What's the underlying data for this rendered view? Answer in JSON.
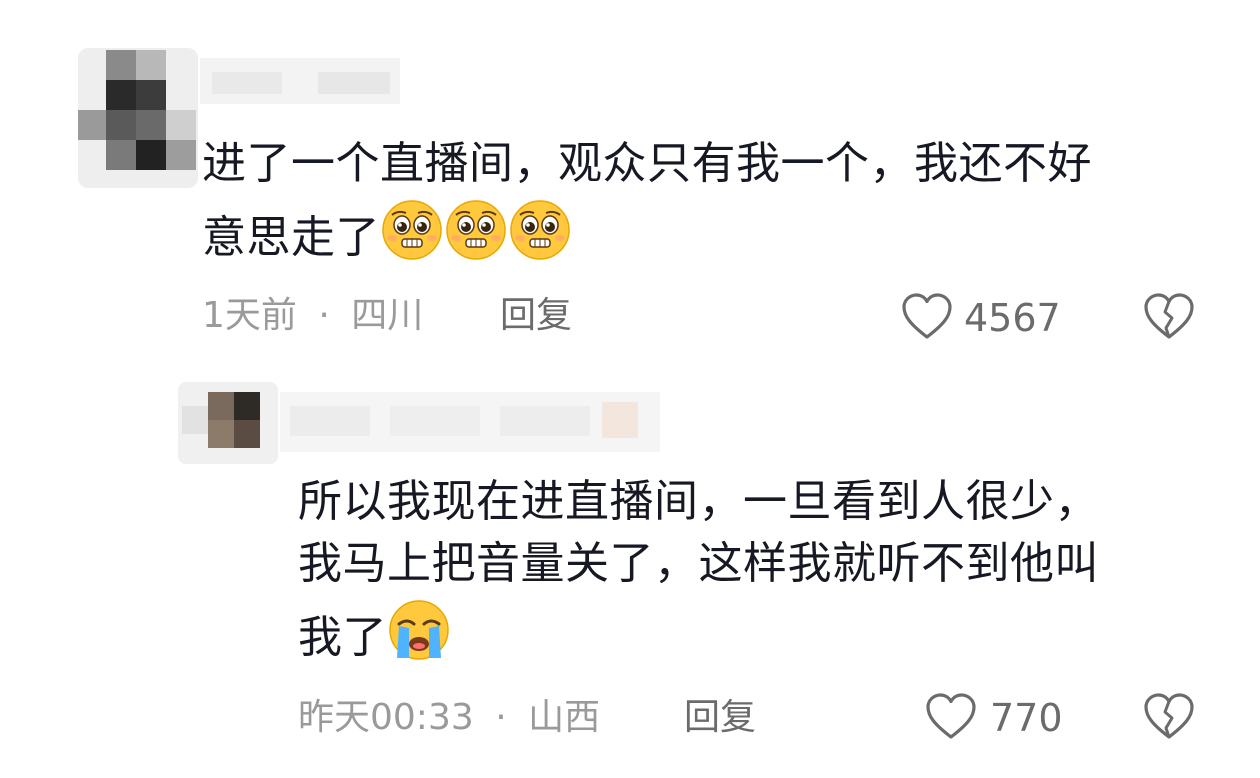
{
  "comments": [
    {
      "text_line1": "进了一个直播间，观众只有我一个，我还不好",
      "text_line2": "意思走了",
      "emojis": [
        "pleading-face",
        "pleading-face",
        "pleading-face"
      ],
      "time": "1天前",
      "separator": "·",
      "location": "四川",
      "reply_label": "回复",
      "likes": "4567",
      "username_blurred": true
    },
    {
      "text_line1": "所以我现在进直播间，一旦看到人很少，",
      "text_line2": "我马上把音量关了，这样我就听不到他叫",
      "text_line3": "我了",
      "emojis": [
        "loudly-crying-face"
      ],
      "time": "昨天00:33",
      "separator": "·",
      "location": "山西",
      "reply_label": "回复",
      "likes": "770",
      "username_blurred": true
    }
  ],
  "colors": {
    "text": "#161823",
    "meta": "#9a9a9a",
    "action": "#6b6b6b",
    "emoji_yellow": "#ffc83d"
  }
}
